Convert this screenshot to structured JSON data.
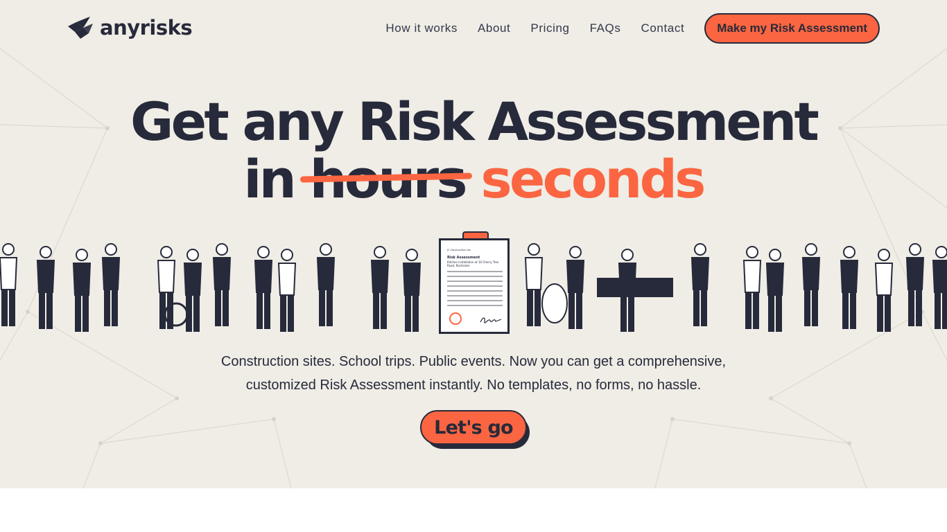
{
  "brand": {
    "name": "anyrisks"
  },
  "nav": {
    "links": [
      "How it works",
      "About",
      "Pricing",
      "FAQs",
      "Contact"
    ],
    "cta_label": "Make my Risk Assessment"
  },
  "hero": {
    "headline_line1": "Get any Risk Assessment",
    "headline_in": "in",
    "headline_struck": "hours",
    "headline_accent": "seconds",
    "tagline_line1": "Construction sites. School trips. Public events. Now you can get a comprehensive,",
    "tagline_line2": "customized Risk Assessment instantly. No templates, no forms, no hassle.",
    "cta_label": "Let's go"
  },
  "document": {
    "company": "JC Construction Ltd.",
    "title": "Risk Assessment",
    "subtitle": "Kitchen installation at 10 Cherry Tree Road, Rochester"
  },
  "colors": {
    "accent": "#fb6541",
    "ink": "#272a3a",
    "hero_background": "#efede6"
  },
  "icons": [
    "logo-bird-icon",
    "stamp-icon",
    "signature-icon"
  ]
}
